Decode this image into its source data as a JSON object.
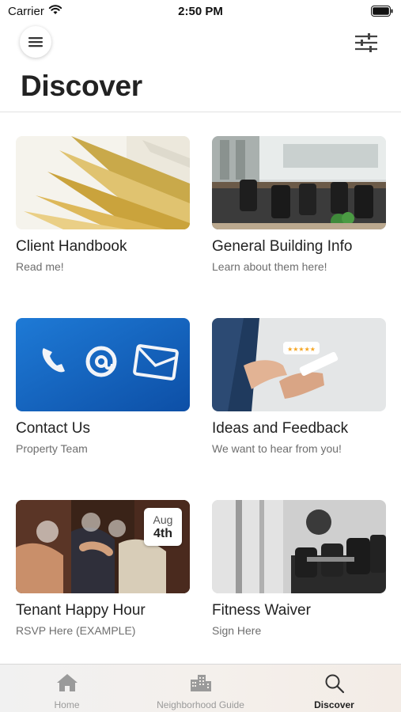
{
  "status_bar": {
    "carrier": "Carrier",
    "time": "2:50 PM"
  },
  "header": {
    "title": "Discover",
    "menu_icon": "hamburger-menu-icon",
    "filter_icon": "sliders-icon"
  },
  "cards": [
    {
      "title": "Client Handbook",
      "subtitle": "Read me!",
      "image": "open-book-pages"
    },
    {
      "title": "General Building Info",
      "subtitle": "Learn about them here!",
      "image": "office-workspace"
    },
    {
      "title": "Contact Us",
      "subtitle": "Property Team",
      "image": "phone-at-envelope-icons"
    },
    {
      "title": "Ideas and Feedback",
      "subtitle": "We want to hear from you!",
      "image": "hand-with-phone-rating"
    },
    {
      "title": "Tenant Happy Hour",
      "subtitle": "RSVP Here (EXAMPLE)",
      "image": "people-toasting",
      "badge": {
        "month": "Aug",
        "day": "4th"
      }
    },
    {
      "title": "Fitness Waiver",
      "subtitle": "Sign Here",
      "image": "dumbbell-rack"
    }
  ],
  "tabs": [
    {
      "label": "Home",
      "icon": "home-icon",
      "active": false
    },
    {
      "label": "Neighborhood Guide",
      "icon": "buildings-icon",
      "active": false
    },
    {
      "label": "Discover",
      "icon": "search-icon",
      "active": true
    }
  ],
  "colors": {
    "accent": "#222222",
    "inactive_tab": "#9a9a9a",
    "subtitle": "#6e6e6e",
    "contact_blue": "#1565c0"
  }
}
